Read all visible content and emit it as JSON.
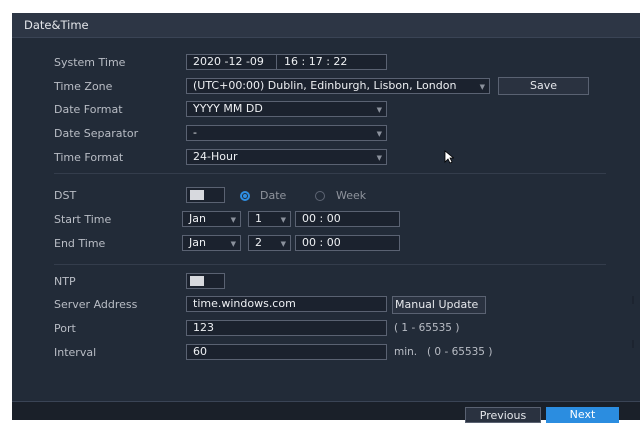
{
  "window": {
    "title": "Date&Time"
  },
  "system_time": {
    "label": "System Time",
    "date": "2020 -12 -09",
    "time": "16 : 17 : 22"
  },
  "time_zone": {
    "label": "Time Zone",
    "value": "(UTC+00:00) Dublin, Edinburgh, Lisbon, London",
    "save_label": "Save"
  },
  "date_format": {
    "label": "Date Format",
    "value": "YYYY MM DD"
  },
  "date_separator": {
    "label": "Date Separator",
    "value": "-"
  },
  "time_format": {
    "label": "Time Format",
    "value": "24-Hour"
  },
  "dst": {
    "label": "DST",
    "enabled": false,
    "mode_options": [
      "Date",
      "Week"
    ],
    "selected_mode": "Date",
    "start": {
      "label": "Start Time",
      "month": "Jan",
      "day": "1",
      "time": "00 : 00"
    },
    "end": {
      "label": "End Time",
      "month": "Jan",
      "day": "2",
      "time": "00 : 00"
    }
  },
  "ntp": {
    "label": "NTP",
    "enabled": false,
    "server_label": "Server Address",
    "server_value": "time.windows.com",
    "manual_update_label": "Manual Update",
    "port_label": "Port",
    "port_value": "123",
    "port_range": "( 1 - 65535 )",
    "interval_label": "Interval",
    "interval_value": "60",
    "interval_unit": "min.",
    "interval_range": "( 0 - 65535 )"
  },
  "footer": {
    "previous_label": "Previous",
    "next_label": "Next"
  },
  "colors": {
    "background": "#222b38",
    "accent": "#2b8de0",
    "field_border": "#5a6272"
  },
  "icons": {
    "dropdown": "chevron-down-icon",
    "cursor": "mouse-pointer-icon"
  }
}
